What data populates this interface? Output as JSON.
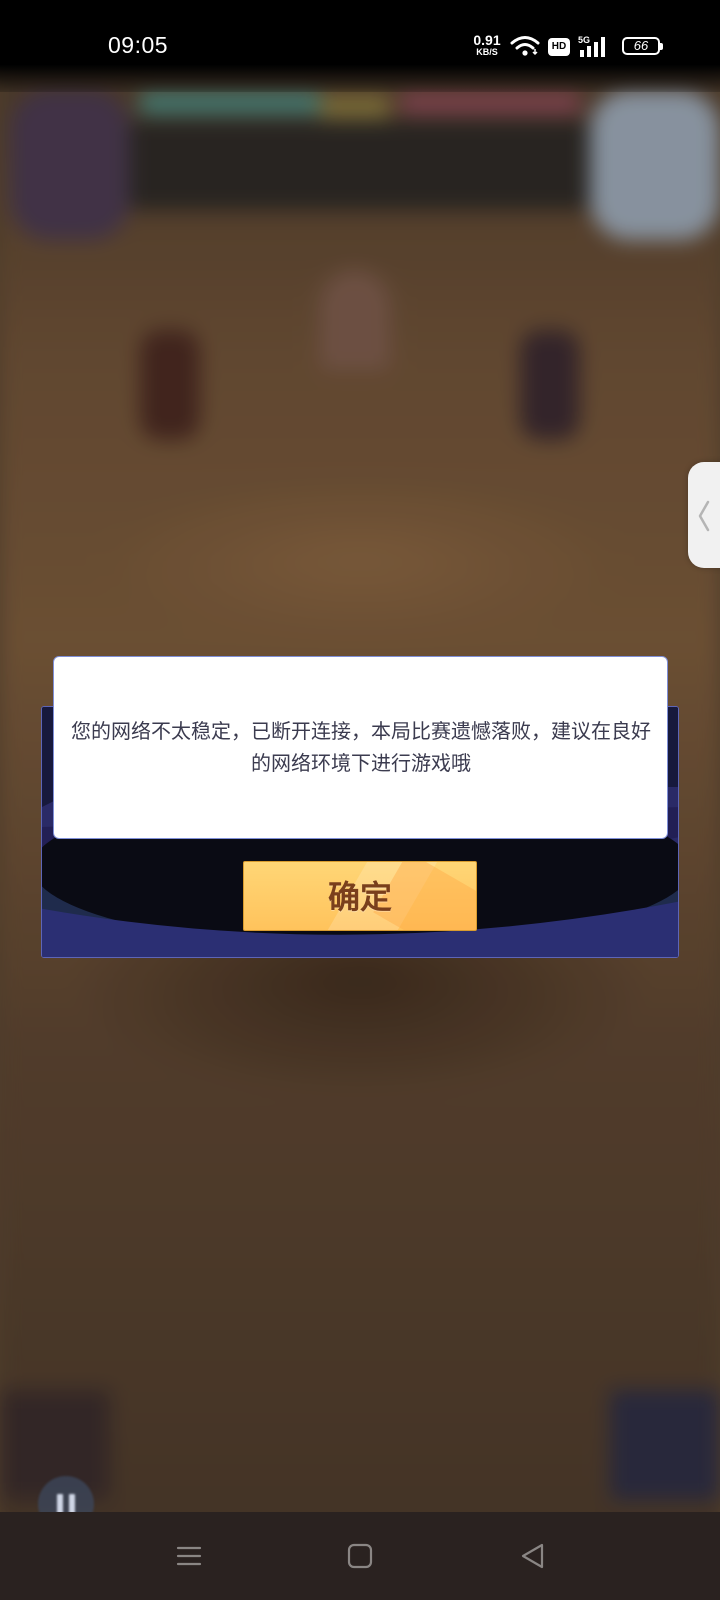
{
  "status_bar": {
    "time": "09:05",
    "net_speed_value": "0.91",
    "net_speed_unit": "KB/S",
    "hd_badge": "HD",
    "network_type": "5G",
    "battery": "66",
    "icons": [
      "wifi-icon",
      "signal-icon",
      "battery-icon"
    ]
  },
  "dialog": {
    "message": "您的网络不太稳定，已断开连接，本局比赛遗憾落败，建议在良好的网络环境下进行游戏哦",
    "confirm_label": "确定"
  },
  "colors": {
    "confirm_button": "#ffc35c",
    "confirm_text": "#7a3f1c",
    "dialog_border": "#7f8fd8",
    "nav_bar": "#2a2220"
  },
  "navigation": {
    "buttons": [
      "menu-icon",
      "home-icon",
      "back-icon"
    ]
  },
  "side_handle": {
    "icon": "chevron-left-icon"
  },
  "game": {
    "corner_button_icon": "pause-icon"
  }
}
